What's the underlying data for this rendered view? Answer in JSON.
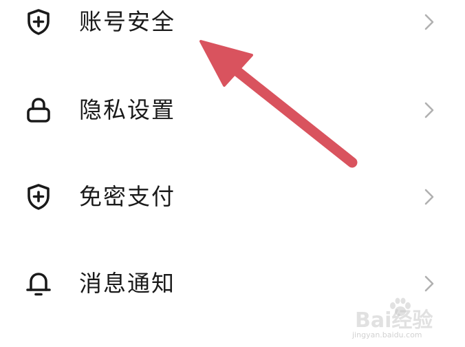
{
  "menu": {
    "items": [
      {
        "label": "账号安全",
        "icon": "shield-plus-icon"
      },
      {
        "label": "隐私设置",
        "icon": "lock-icon"
      },
      {
        "label": "免密支付",
        "icon": "shield-plus-icon"
      },
      {
        "label": "消息通知",
        "icon": "bell-icon"
      }
    ],
    "chevron_icon": "chevron-right-icon"
  },
  "annotation": {
    "icon": "arrow-annotation-icon",
    "color": "#d9535e"
  },
  "colors": {
    "text": "#1a1a1a",
    "chevron": "#b0b0b0",
    "background": "#ffffff"
  },
  "watermark": {
    "brand": "Bai经验",
    "site": "jingyan.baidu.com"
  }
}
